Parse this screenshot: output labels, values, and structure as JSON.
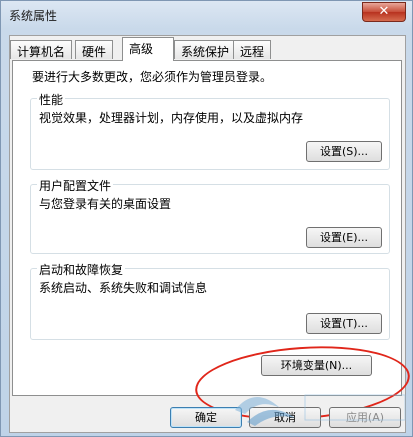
{
  "window": {
    "title": "系统属性",
    "close_glyph": "✕"
  },
  "tabs": [
    {
      "label": "计算机名",
      "active": false
    },
    {
      "label": "硬件",
      "active": false
    },
    {
      "label": "高级",
      "active": true
    },
    {
      "label": "系统保护",
      "active": false
    },
    {
      "label": "远程",
      "active": false
    }
  ],
  "notice": "要进行大多数更改，您必须作为管理员登录。",
  "groups": {
    "performance": {
      "title": "性能",
      "desc": "视觉效果，处理器计划，内存使用，以及虚拟内存",
      "button": "设置(S)..."
    },
    "profile": {
      "title": "用户配置文件",
      "desc": "与您登录有关的桌面设置",
      "button": "设置(E)..."
    },
    "startup": {
      "title": "启动和故障恢复",
      "desc": "系统启动、系统失败和调试信息",
      "button": "设置(T)..."
    }
  },
  "env_button": "环境变量(N)...",
  "footer": {
    "ok": "确定",
    "cancel": "取消",
    "apply": "应用(A)"
  },
  "annotation": {
    "color": "#e0261a"
  }
}
